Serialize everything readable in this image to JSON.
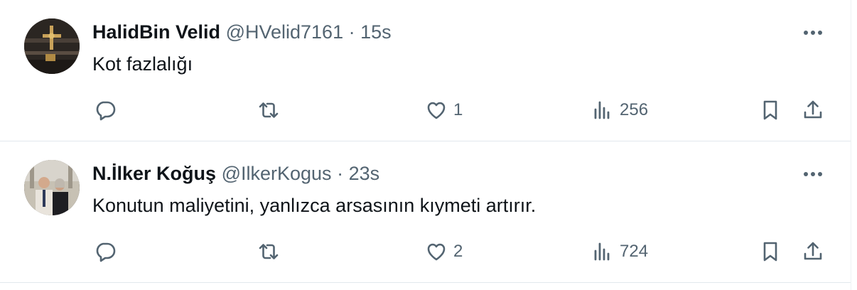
{
  "tweets": [
    {
      "name": "HalidBin Velid",
      "handle": "@HVelid7161",
      "separator": "·",
      "time": "15s",
      "text": "Kot fazlalığı",
      "likes": "1",
      "views": "256"
    },
    {
      "name": "N.İlker Koğuş",
      "handle": "@IlkerKogus",
      "separator": "·",
      "time": "23s",
      "text": "Konutun maliyetini, yanlızca arsasının kıymeti artırır.",
      "likes": "2",
      "views": "724"
    }
  ],
  "icons": {
    "more": "more-icon",
    "reply": "reply-icon",
    "retweet": "retweet-icon",
    "like": "heart-icon",
    "views": "views-icon",
    "bookmark": "bookmark-icon",
    "share": "share-icon"
  },
  "colors": {
    "text": "#0f1419",
    "secondary": "#536471",
    "divider": "#e1e8ed"
  }
}
